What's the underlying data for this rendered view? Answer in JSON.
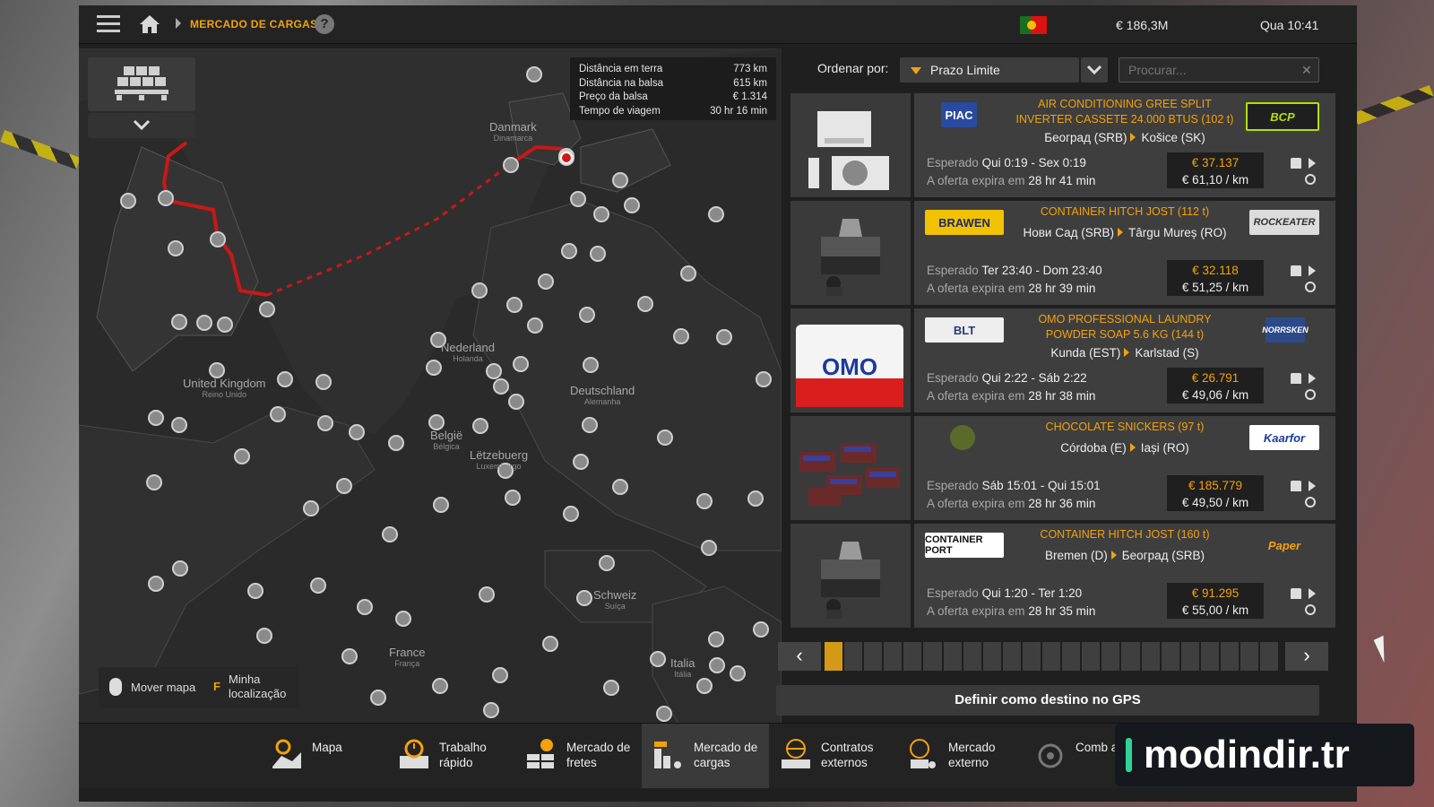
{
  "topbar": {
    "breadcrumb": "MERCADO DE CARGAS",
    "help": "?",
    "money": "€ 186,3M",
    "clock": "Qua 10:41"
  },
  "route_info": {
    "rows": [
      {
        "label": "Distância em terra",
        "value": "773 km"
      },
      {
        "label": "Distância na balsa",
        "value": "615 km"
      },
      {
        "label": "Preço da balsa",
        "value": "€ 1.314"
      },
      {
        "label": "Tempo de viagem",
        "value": "30 hr 16 min"
      }
    ]
  },
  "map": {
    "countries": [
      {
        "name": "Danmark",
        "local": "Dinamarca"
      },
      {
        "name": "Nederland",
        "local": "Holanda"
      },
      {
        "name": "Deutschland",
        "local": "Alemanha"
      },
      {
        "name": "United Kingdom",
        "local": "Reino Unido"
      },
      {
        "name": "België",
        "local": "Bélgica"
      },
      {
        "name": "Lëtzebuerg",
        "local": "Luxemburgo"
      },
      {
        "name": "Schweiz",
        "local": "Suíça"
      },
      {
        "name": "France",
        "local": "França"
      },
      {
        "name": "Italia",
        "local": "Itália"
      }
    ],
    "hint_move": "Mover mapa",
    "hint_key": "F",
    "hint_location": "Minha localização"
  },
  "sort": {
    "label": "Ordenar por:",
    "value": "Prazo Limite",
    "search_placeholder": "Procurar...",
    "clear": "✕"
  },
  "offers": [
    {
      "company_left": "PIAC",
      "company_right": "BCP",
      "cargo": "AIR CONDITIONING GREE SPLIT INVERTER CASSETE 24.000 BTUS (102 t)",
      "from": "Београд (SRB)",
      "to": "Košice (SK)",
      "expected_label": "Esperado",
      "expected": "Qui 0:19 - Sex 0:19",
      "expires_label": "A oferta expira em",
      "expires": "28 hr 41 min",
      "total": "€ 37.137",
      "per_km": "€ 61,10 / km"
    },
    {
      "company_left": "BRAWEN",
      "company_right": "ROCKEATER",
      "cargo": "CONTAINER HITCH JOST (112 t)",
      "from": "Нови Сад (SRB)",
      "to": "Târgu Mureș (RO)",
      "expected_label": "Esperado",
      "expected": "Ter 23:40 - Dom 23:40",
      "expires_label": "A oferta expira em",
      "expires": "28 hr 39 min",
      "total": "€ 32.118",
      "per_km": "€ 51,25 / km"
    },
    {
      "company_left": "BLT",
      "company_right": "NORRSKEN",
      "cargo": "OMO PROFESSIONAL LAUNDRY POWDER SOAP 5.6 KG (144 t)",
      "from": "Kunda (EST)",
      "to": "Karlstad (S)",
      "expected_label": "Esperado",
      "expected": "Qui 2:22 - Sáb 2:22",
      "expires_label": "A oferta expira em",
      "expires": "28 hr 38 min",
      "total": "€ 26.791",
      "per_km": "€ 49,06 / km"
    },
    {
      "company_left": "",
      "company_right": "Kaarfor",
      "cargo": "CHOCOLATE SNICKERS (97 t)",
      "from": "Córdoba (E)",
      "to": "Iași (RO)",
      "expected_label": "Esperado",
      "expected": "Sáb 15:01 - Qui 15:01",
      "expires_label": "A oferta expira em",
      "expires": "28 hr 36 min",
      "total": "€ 185.779",
      "per_km": "€ 49,50 / km"
    },
    {
      "company_left": "CONTAINER PORT",
      "company_right": "Paper",
      "cargo": "CONTAINER HITCH JOST (160 t)",
      "from": "Bremen (D)",
      "to": "Београд (SRB)",
      "expected_label": "Esperado",
      "expected": "Qui 1:20 - Ter 1:20",
      "expires_label": "A oferta expira em",
      "expires": "28 hr 35 min",
      "total": "€ 91.295",
      "per_km": "€ 55,00 / km"
    }
  ],
  "pager": {
    "prev": "‹",
    "next": "›",
    "pages": 23,
    "current": 1
  },
  "gps_button": "Definir como destino no GPS",
  "nav": [
    {
      "label": "Mapa",
      "icon": "map-icon",
      "active": false
    },
    {
      "label": "Trabalho rápido",
      "icon": "clock-icon",
      "active": false
    },
    {
      "label": "Mercado de fretes",
      "icon": "freight-icon",
      "active": false
    },
    {
      "label": "Mercado de cargas",
      "icon": "cargo-market-icon",
      "active": true
    },
    {
      "label": "Contratos externos",
      "icon": "globe-icon",
      "active": false
    },
    {
      "label": "Mercado externo",
      "icon": "globe-truck-icon",
      "active": false
    },
    {
      "label": "Comb ativo",
      "icon": "convoy-icon",
      "active": false
    }
  ],
  "watermark": "modindir.tr",
  "colors": {
    "accent": "#f2a20b",
    "route": "#c81818",
    "panel": "#3e3e3e"
  }
}
